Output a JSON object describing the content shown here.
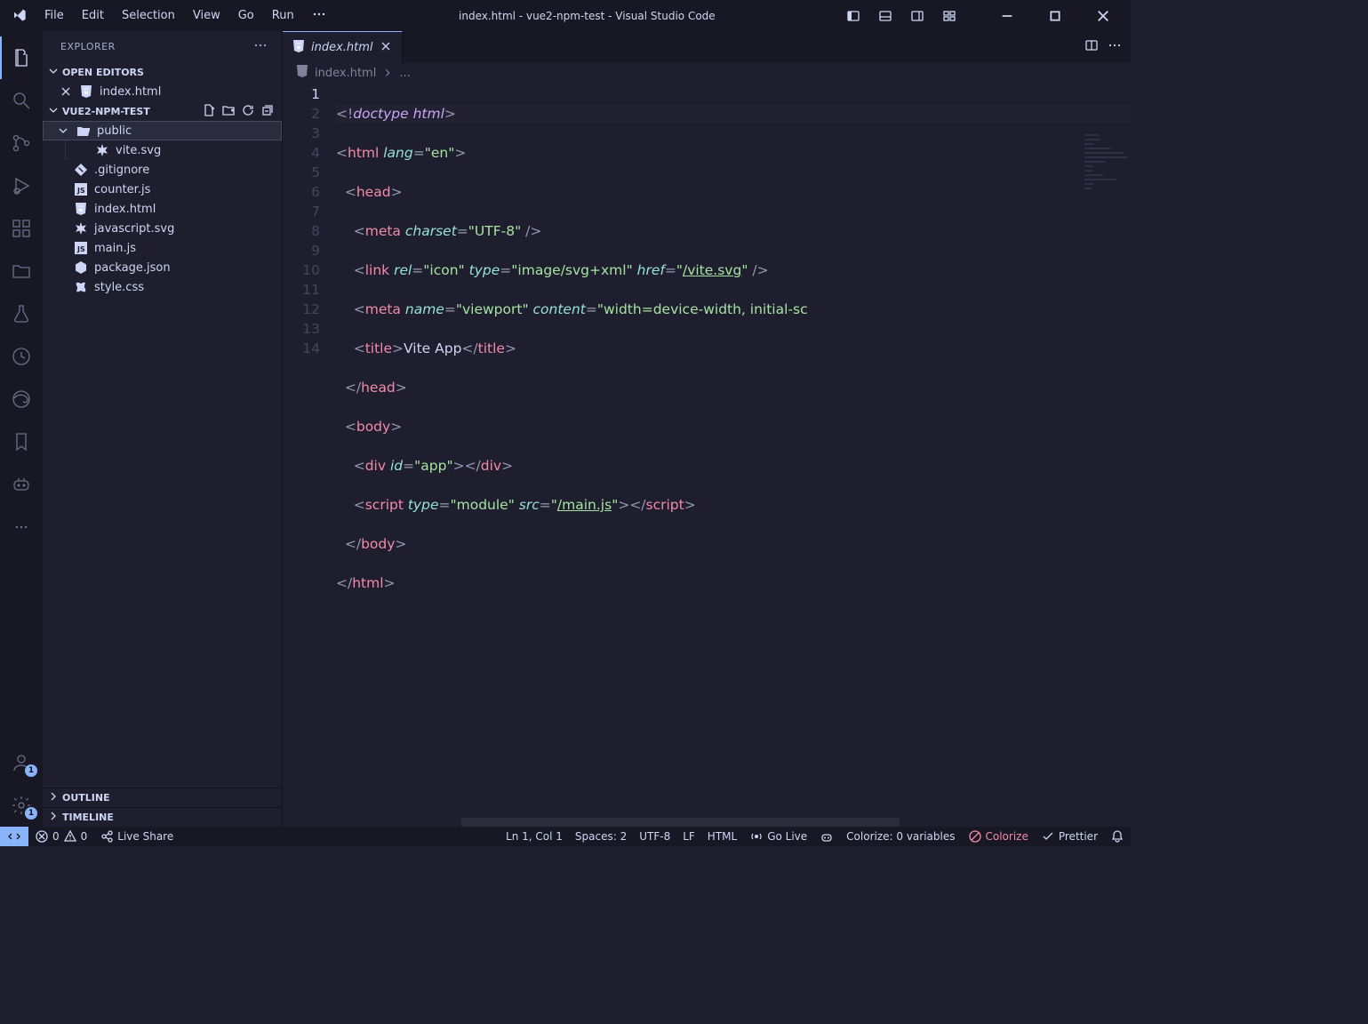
{
  "title": "index.html - vue2-npm-test - Visual Studio Code",
  "menu": [
    "File",
    "Edit",
    "Selection",
    "View",
    "Go",
    "Run"
  ],
  "sidebar": {
    "title": "EXPLORER",
    "openEditorsLabel": "OPEN EDITORS",
    "openEditors": [
      {
        "name": "index.html",
        "icon": "html5"
      }
    ],
    "project": "VUE2-NPM-TEST",
    "tree": [
      {
        "name": "public",
        "type": "folder",
        "expanded": true,
        "depth": 0,
        "selected": true
      },
      {
        "name": "vite.svg",
        "type": "file",
        "icon": "asterisk-yellow",
        "depth": 1
      },
      {
        "name": ".gitignore",
        "type": "file",
        "icon": "git-orange",
        "depth": 0
      },
      {
        "name": "counter.js",
        "type": "file",
        "icon": "js",
        "depth": 0
      },
      {
        "name": "index.html",
        "type": "file",
        "icon": "html5",
        "depth": 0
      },
      {
        "name": "javascript.svg",
        "type": "file",
        "icon": "asterisk-yellow",
        "depth": 0
      },
      {
        "name": "main.js",
        "type": "file",
        "icon": "js",
        "depth": 0
      },
      {
        "name": "package.json",
        "type": "file",
        "icon": "node-green",
        "depth": 0
      },
      {
        "name": "style.css",
        "type": "file",
        "icon": "css-blue",
        "depth": 0
      }
    ],
    "outline": "OUTLINE",
    "timeline": "TIMELINE"
  },
  "tab": {
    "name": "index.html"
  },
  "breadcrumb": {
    "file": "index.html",
    "more": "..."
  },
  "lineNumbers": [
    "1",
    "2",
    "3",
    "4",
    "5",
    "6",
    "7",
    "8",
    "9",
    "10",
    "11",
    "12",
    "13",
    "14"
  ],
  "status": {
    "errors": "0",
    "warnings": "0",
    "liveShare": "Live Share",
    "pos": "Ln 1, Col 1",
    "spaces": "Spaces: 2",
    "encoding": "UTF-8",
    "eol": "LF",
    "lang": "HTML",
    "goLive": "Go Live",
    "colorizeVars": "Colorize: 0 variables",
    "colorize": "Colorize",
    "prettier": "Prettier"
  },
  "codeContent": {
    "doctype": "doctype html",
    "htmlLang": "\"en\"",
    "charset": "\"UTF-8\"",
    "iconRel": "\"icon\"",
    "iconType": "\"image/svg+xml\"",
    "iconHref": "/vite.svg",
    "viewportName": "\"viewport\"",
    "viewportContent": "\"width=device-width, initial-sc",
    "titleText": "Vite App",
    "appId": "\"app\"",
    "scriptType": "\"module\"",
    "scriptSrc": "/main.js"
  }
}
